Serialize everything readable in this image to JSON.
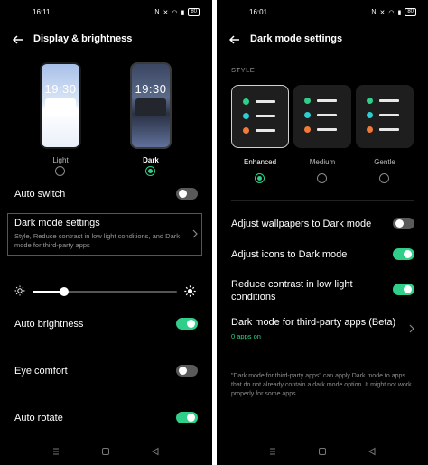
{
  "left": {
    "status": {
      "time": "16:11",
      "battery": "80"
    },
    "header": {
      "title": "Display & brightness"
    },
    "modes": {
      "clock": "19:30",
      "light_label": "Light",
      "dark_label": "Dark",
      "selected": "Dark"
    },
    "auto_switch": {
      "label": "Auto switch",
      "on": false
    },
    "dark_mode_settings": {
      "label": "Dark mode settings",
      "sub": "Style, Reduce contrast in low light conditions, and Dark mode for third-party apps"
    },
    "brightness": {
      "level": 0.22
    },
    "auto_brightness": {
      "label": "Auto brightness",
      "on": true
    },
    "eye_comfort": {
      "label": "Eye comfort",
      "on": false
    },
    "auto_rotate": {
      "label": "Auto rotate",
      "on": true
    }
  },
  "right": {
    "status": {
      "time": "16:01",
      "battery": "80"
    },
    "header": {
      "title": "Dark mode settings"
    },
    "style": {
      "section": "STYLE",
      "options": [
        {
          "label": "Enhanced",
          "selected": true
        },
        {
          "label": "Medium",
          "selected": false
        },
        {
          "label": "Gentle",
          "selected": false
        }
      ]
    },
    "wallpapers": {
      "label": "Adjust wallpapers to Dark mode",
      "on": false
    },
    "icons": {
      "label": "Adjust icons to Dark mode",
      "on": true
    },
    "contrast": {
      "label": "Reduce contrast in low light conditions",
      "on": true
    },
    "third_party": {
      "label": "Dark mode for third-party apps (Beta)",
      "sub": "0 apps on"
    },
    "note": "\"Dark mode for third-party apps\" can apply Dark mode to apps that do not already contain a dark mode option. It might not work properly for some apps."
  },
  "colors": {
    "accent": "#2fcf8a",
    "highlight": "#d32020",
    "background": "#000000"
  }
}
